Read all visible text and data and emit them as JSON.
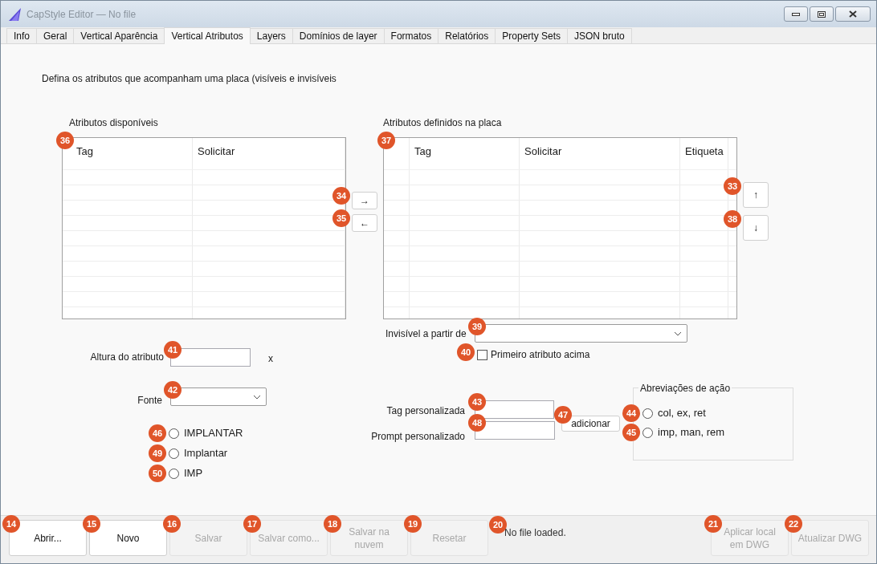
{
  "window": {
    "title": "CapStyle Editor — No file"
  },
  "tabs": [
    {
      "label": "Info",
      "selected": false
    },
    {
      "label": "Geral",
      "selected": false
    },
    {
      "label": "Vertical Aparência",
      "selected": false
    },
    {
      "label": "Vertical Atributos",
      "selected": true
    },
    {
      "label": "Layers",
      "selected": false
    },
    {
      "label": "Domínios de layer",
      "selected": false
    },
    {
      "label": "Formatos",
      "selected": false
    },
    {
      "label": "Relatórios",
      "selected": false
    },
    {
      "label": "Property Sets",
      "selected": false
    },
    {
      "label": "JSON bruto",
      "selected": false
    }
  ],
  "intro": "Defina os atributos que acompanham uma placa (visíveis e invisíveis",
  "available": {
    "label": "Atributos disponíveis",
    "marker": "36",
    "columns": [
      "Tag",
      "Solicitar"
    ]
  },
  "move_buttons": [
    {
      "label": "→",
      "marker": "34"
    },
    {
      "label": "←",
      "marker": "35"
    }
  ],
  "defined": {
    "label": "Atributos definidos na placa",
    "marker": "37",
    "columns": [
      "Tag",
      "Solicitar",
      "Etiqueta"
    ]
  },
  "order_buttons": [
    {
      "label": "↑",
      "marker": "33"
    },
    {
      "label": "↓",
      "marker": "38"
    }
  ],
  "invisible_from": {
    "label": "Invisível a partir de",
    "marker": "39"
  },
  "first_above": {
    "label": "Primeiro atributo acima",
    "checked": false,
    "marker": "40"
  },
  "attribute_height": {
    "label": "Altura do atributo",
    "marker": "41",
    "unit": "x"
  },
  "font": {
    "label": "Fonte",
    "marker": "42"
  },
  "case_options": [
    {
      "label": "IMPLANTAR",
      "selected": false,
      "marker": "46"
    },
    {
      "label": "Implantar",
      "selected": false,
      "marker": "49"
    },
    {
      "label": "IMP",
      "selected": false,
      "marker": "50"
    }
  ],
  "custom_tag": {
    "label": "Tag personalizada",
    "marker": "43"
  },
  "custom_prompt": {
    "label": "Prompt personalizado",
    "marker": "48"
  },
  "add_button": {
    "label": "adicionar",
    "marker": "47"
  },
  "abbreviations": {
    "title": "Abreviações de ação",
    "options": [
      {
        "label": "col, ex, ret",
        "selected": false,
        "marker": "44"
      },
      {
        "label": "imp, man, rem",
        "selected": false,
        "marker": "45"
      }
    ]
  },
  "bottom_buttons": [
    {
      "label": "Abrir...",
      "disabled": false,
      "marker": "14"
    },
    {
      "label": "Novo",
      "disabled": false,
      "marker": "15"
    },
    {
      "label": "Salvar",
      "disabled": true,
      "marker": "16"
    },
    {
      "label": "Salvar como...",
      "disabled": true,
      "marker": "17"
    },
    {
      "label": "Salvar na nuvem",
      "disabled": true,
      "marker": "18"
    },
    {
      "label": "Resetar",
      "disabled": true,
      "marker": "19"
    }
  ],
  "status": {
    "text": "No file loaded.",
    "marker": "20"
  },
  "right_buttons": [
    {
      "label": "Aplicar local em DWG",
      "disabled": true,
      "marker": "21"
    },
    {
      "label": "Atualizar DWG",
      "disabled": true,
      "marker": "22"
    }
  ]
}
